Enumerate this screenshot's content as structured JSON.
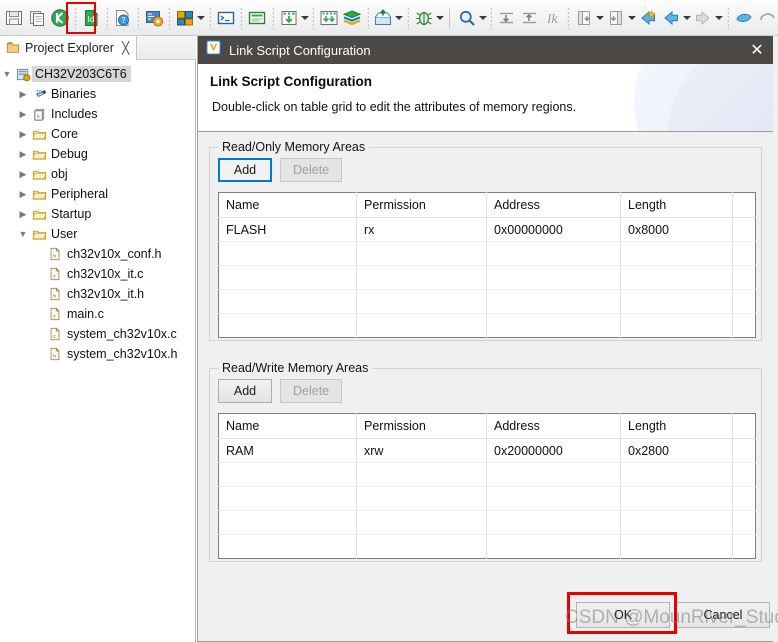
{
  "toolbar": {
    "items": [
      {
        "name": "save-icon",
        "kind": "icon"
      },
      {
        "name": "copy-icon",
        "kind": "icon"
      },
      {
        "name": "build-project-icon",
        "kind": "icon"
      },
      {
        "name": "separator",
        "kind": "sep"
      },
      {
        "name": "link-script-config-icon",
        "kind": "icon",
        "highlighted": true
      },
      {
        "name": "separator",
        "kind": "sep"
      },
      {
        "name": "help-doc-icon",
        "kind": "icon"
      },
      {
        "name": "separator",
        "kind": "sep"
      },
      {
        "name": "settings-gear-icon",
        "kind": "icon"
      },
      {
        "name": "separator",
        "kind": "sep"
      },
      {
        "name": "perspective-icon",
        "kind": "icon"
      },
      {
        "name": "dropdown-arrow",
        "kind": "arrow"
      },
      {
        "name": "separator",
        "kind": "sep"
      },
      {
        "name": "terminal-icon",
        "kind": "icon"
      },
      {
        "name": "separator",
        "kind": "sep"
      },
      {
        "name": "console-icon",
        "kind": "icon"
      },
      {
        "name": "separator",
        "kind": "sep"
      },
      {
        "name": "download-icon",
        "kind": "icon"
      },
      {
        "name": "dropdown-arrow",
        "kind": "arrow"
      },
      {
        "name": "separator",
        "kind": "sep"
      },
      {
        "name": "download-all-icon",
        "kind": "icon"
      },
      {
        "name": "library-stack-icon",
        "kind": "icon"
      },
      {
        "name": "separator",
        "kind": "sep"
      },
      {
        "name": "export-icon",
        "kind": "icon"
      },
      {
        "name": "dropdown-arrow",
        "kind": "arrow"
      },
      {
        "name": "separator",
        "kind": "sep"
      },
      {
        "name": "debug-bug-icon",
        "kind": "icon"
      },
      {
        "name": "dropdown-arrow",
        "kind": "arrow"
      },
      {
        "name": "divider",
        "kind": "div"
      },
      {
        "name": "search-icon",
        "kind": "icon"
      },
      {
        "name": "dropdown-arrow",
        "kind": "arrow"
      },
      {
        "name": "separator",
        "kind": "sep"
      },
      {
        "name": "next-annotation-icon",
        "kind": "icon"
      },
      {
        "name": "previous-annotation-icon",
        "kind": "icon"
      },
      {
        "name": "last-edit-icon",
        "kind": "icon"
      },
      {
        "name": "separator",
        "kind": "sep"
      },
      {
        "name": "previous-edit-icon",
        "kind": "icon"
      },
      {
        "name": "dropdown-arrow",
        "kind": "arrow"
      },
      {
        "name": "next-edit-icon",
        "kind": "icon"
      },
      {
        "name": "dropdown-arrow",
        "kind": "arrow"
      },
      {
        "name": "back-icon",
        "kind": "icon"
      },
      {
        "name": "back-history-icon",
        "kind": "icon"
      },
      {
        "name": "dropdown-arrow",
        "kind": "arrow"
      },
      {
        "name": "forward-icon",
        "kind": "icon"
      },
      {
        "name": "dropdown-arrow",
        "kind": "arrow"
      },
      {
        "name": "separator",
        "kind": "sep"
      },
      {
        "name": "pin-editor-icon",
        "kind": "icon"
      },
      {
        "name": "restore-icon",
        "kind": "icon"
      }
    ]
  },
  "left_panel": {
    "tab": {
      "label": "Project Explorer",
      "close_glyph": "╳",
      "icon": "project-explorer-icon"
    },
    "tree": [
      {
        "label": "CH32V203C6T6",
        "depth": 0,
        "expander": "▼",
        "icon": "project-icon",
        "selected": true
      },
      {
        "label": "Binaries",
        "depth": 1,
        "expander": "▶",
        "icon": "binaries-icon",
        "selected": false
      },
      {
        "label": "Includes",
        "depth": 1,
        "expander": "▶",
        "icon": "includes-icon",
        "selected": false
      },
      {
        "label": "Core",
        "depth": 1,
        "expander": "▶",
        "icon": "folder-icon",
        "selected": false
      },
      {
        "label": "Debug",
        "depth": 1,
        "expander": "▶",
        "icon": "folder-icon",
        "selected": false
      },
      {
        "label": "obj",
        "depth": 1,
        "expander": "▶",
        "icon": "folder-icon",
        "selected": false
      },
      {
        "label": "Peripheral",
        "depth": 1,
        "expander": "▶",
        "icon": "folder-icon",
        "selected": false
      },
      {
        "label": "Startup",
        "depth": 1,
        "expander": "▶",
        "icon": "folder-icon",
        "selected": false
      },
      {
        "label": "User",
        "depth": 1,
        "expander": "▼",
        "icon": "folder-icon",
        "selected": false
      },
      {
        "label": "ch32v10x_conf.h",
        "depth": 2,
        "expander": "",
        "icon": "h-file-icon",
        "selected": false
      },
      {
        "label": "ch32v10x_it.c",
        "depth": 2,
        "expander": "",
        "icon": "c-file-icon",
        "selected": false
      },
      {
        "label": "ch32v10x_it.h",
        "depth": 2,
        "expander": "",
        "icon": "h-file-icon",
        "selected": false
      },
      {
        "label": "main.c",
        "depth": 2,
        "expander": "",
        "icon": "c-file-icon",
        "selected": false
      },
      {
        "label": "system_ch32v10x.c",
        "depth": 2,
        "expander": "",
        "icon": "c-file-icon",
        "selected": false
      },
      {
        "label": "system_ch32v10x.h",
        "depth": 2,
        "expander": "",
        "icon": "h-file-icon",
        "selected": false
      }
    ]
  },
  "dialog": {
    "titlebar": {
      "title": "Link Script Configuration",
      "icon": "mounriver-logo-icon",
      "close_glyph": "✕"
    },
    "header": {
      "title": "Link Script Configuration",
      "subtitle": "Double-click on table grid to edit the attributes of memory regions."
    },
    "groups": [
      {
        "legend": "Read/Only Memory Areas",
        "add_label": "Add",
        "delete_label": "Delete",
        "add_focused": true,
        "delete_disabled": true,
        "columns": [
          "Name",
          "Permission",
          "Address",
          "Length",
          ""
        ],
        "rows": [
          [
            "FLASH",
            "rx",
            "0x00000000",
            "0x8000",
            ""
          ],
          [
            "",
            "",
            "",
            "",
            ""
          ],
          [
            "",
            "",
            "",
            "",
            ""
          ],
          [
            "",
            "",
            "",
            "",
            ""
          ],
          [
            "",
            "",
            "",
            "",
            ""
          ]
        ]
      },
      {
        "legend": "Read/Write Memory Areas",
        "add_label": "Add",
        "delete_label": "Delete",
        "add_focused": false,
        "delete_disabled": true,
        "columns": [
          "Name",
          "Permission",
          "Address",
          "Length",
          ""
        ],
        "rows": [
          [
            "RAM",
            "xrw",
            "0x20000000",
            "0x2800",
            ""
          ],
          [
            "",
            "",
            "",
            "",
            ""
          ],
          [
            "",
            "",
            "",
            "",
            ""
          ],
          [
            "",
            "",
            "",
            "",
            ""
          ],
          [
            "",
            "",
            "",
            "",
            ""
          ]
        ]
      }
    ],
    "footer": {
      "ok_label": "OK",
      "cancel_label": "Cancel"
    }
  },
  "watermark": {
    "text": "CSDN @MounRiver_Studio"
  },
  "colors": {
    "titlebar_bg": "#4b4846",
    "dialog_bg": "#f0f0f0",
    "focus_blue": "#0078d7",
    "highlight_red": "#e60000",
    "tree_selection": "#d6d6d6"
  }
}
